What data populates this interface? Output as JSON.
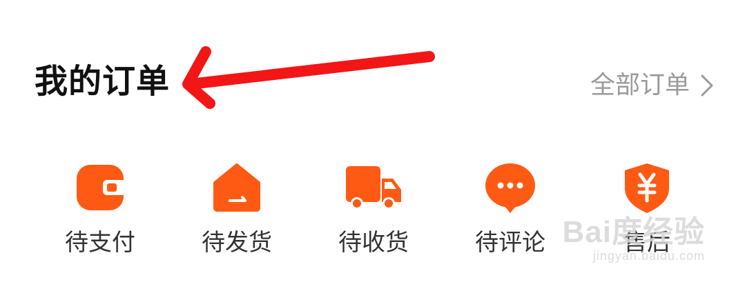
{
  "header": {
    "title": "我的订单",
    "all_orders_label": "全部订单"
  },
  "colors": {
    "accent": "#FF5A14",
    "annotation_arrow": "#F21616",
    "title_text": "#111111",
    "secondary_text": "#9A9A9A",
    "label_text": "#333333"
  },
  "status_items": [
    {
      "label": "待支付",
      "icon": "wallet-icon"
    },
    {
      "label": "待发货",
      "icon": "package-box-icon"
    },
    {
      "label": "待收货",
      "icon": "delivery-truck-icon"
    },
    {
      "label": "待评论",
      "icon": "comment-bubble-icon"
    },
    {
      "label": "售后",
      "icon": "yuan-shield-icon"
    }
  ],
  "watermark": {
    "main": "Bai度经验",
    "sub": "jingyan.baidu.com"
  }
}
